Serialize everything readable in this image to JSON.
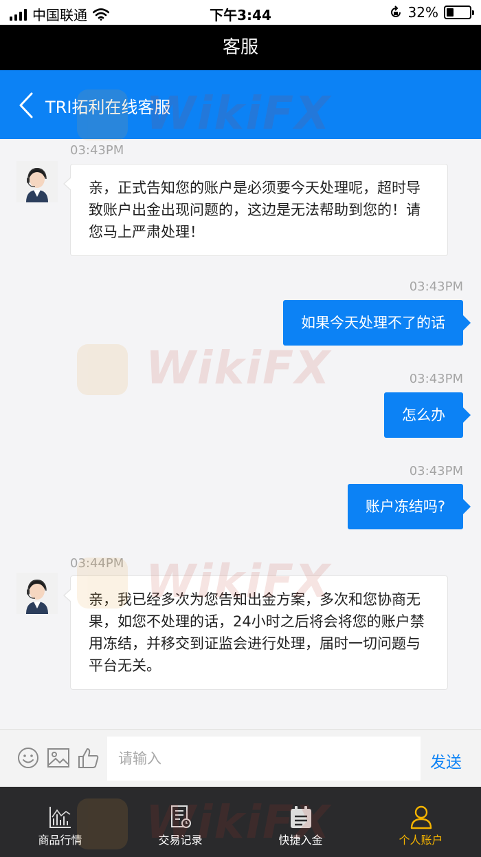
{
  "status_bar": {
    "carrier": "中国联通",
    "time": "下午3:44",
    "battery_percent": "32%",
    "battery_level": 0.32
  },
  "top_bar": {
    "title": "客服"
  },
  "header": {
    "title": "TRI拓利在线客服"
  },
  "messages": [
    {
      "side": "left",
      "time": "03:43PM",
      "text": "亲，正式告知您的账户是必须要今天处理呢，超时导致账户出金出现问题的，这边是无法帮助到您的！请您马上严肃处理！"
    },
    {
      "side": "right",
      "time": "03:43PM",
      "text": "如果今天处理不了的话"
    },
    {
      "side": "right",
      "time": "03:43PM",
      "text": "怎么办"
    },
    {
      "side": "right",
      "time": "03:43PM",
      "text": "账户冻结吗?"
    },
    {
      "side": "left",
      "time": "03:44PM",
      "text": "亲，我已经多次为您告知出金方案，多次和您协商无果，如您不处理的话，24小时之后将会将您的账户禁用冻结，并移交到证监会进行处理，届时一切问题与平台无关。"
    }
  ],
  "input_bar": {
    "placeholder": "请输入",
    "value": "",
    "send_label": "发送",
    "icons": [
      "emoji-icon",
      "image-icon",
      "thumbs-up-icon"
    ]
  },
  "bottom_nav": [
    {
      "label": "商品行情",
      "icon": "chart-icon",
      "active": false
    },
    {
      "label": "交易记录",
      "icon": "record-icon",
      "active": false
    },
    {
      "label": "快捷入金",
      "icon": "calendar-icon",
      "active": false
    },
    {
      "label": "个人账户",
      "icon": "user-icon",
      "active": true
    }
  ],
  "watermark": "WikiFX",
  "colors": {
    "accent": "#0c82f5",
    "nav_active": "#f5b400",
    "nav_bg": "#2a2a2c"
  }
}
